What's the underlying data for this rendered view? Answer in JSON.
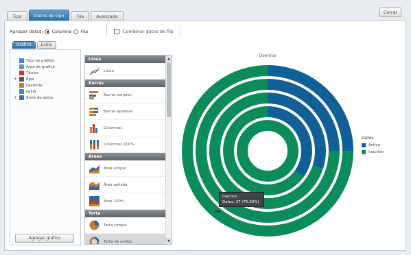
{
  "top_tabs": [
    "Tipo",
    "Datos de tipo",
    "Fila",
    "Avanzado"
  ],
  "close_label": "Cerrar",
  "options": {
    "prefix": "Agrupar datos:",
    "option_columns": "Columna",
    "option_rows": "Fila",
    "selected": "columns"
  },
  "checkbox_label": "Combinar datos de fila",
  "sub_tabs": [
    "Gráfico",
    "Estilo"
  ],
  "tree": [
    {
      "label": "Tipo de gráfico",
      "icon": "chart-type-icon",
      "color": "#4a7fc1",
      "indent": 0,
      "expander": ""
    },
    {
      "label": "Área de gráfico",
      "icon": "chart-area-icon",
      "color": "#6a8fb0",
      "indent": 0,
      "expander": ""
    },
    {
      "label": "Títulos",
      "icon": "titles-icon",
      "color": "#c0392b",
      "indent": 0,
      "expander": ""
    },
    {
      "label": "Ejes",
      "icon": "axis-icon",
      "color": "#555555",
      "indent": 0,
      "expander": "+"
    },
    {
      "label": "Leyenda",
      "icon": "legend-icon",
      "color": "#d07a1e",
      "indent": 0,
      "expander": ""
    },
    {
      "label": "Grilla",
      "icon": "grid-icon",
      "color": "#4a7fc1",
      "indent": 0,
      "expander": ""
    },
    {
      "label": "Serie de datos",
      "icon": "series-icon",
      "color": "#3a6ea5",
      "indent": 0,
      "expander": "+"
    }
  ],
  "add_chart_label": "Agregar gráfico",
  "gallery": {
    "sections": [
      {
        "header": "Línea",
        "items": [
          {
            "label": "Línea",
            "icon": "line-icon"
          }
        ]
      },
      {
        "header": "Barras",
        "items": [
          {
            "label": "Barras simples",
            "icon": "bar-simple-icon"
          },
          {
            "label": "Barras apiladas",
            "icon": "bar-stacked-icon"
          },
          {
            "label": "Columnas",
            "icon": "column-icon"
          },
          {
            "label": "Columnas 100%",
            "icon": "column-100-icon"
          }
        ]
      },
      {
        "header": "Áreas",
        "items": [
          {
            "label": "Área simple",
            "icon": "area-simple-icon"
          },
          {
            "label": "Área apilada",
            "icon": "area-stacked-icon"
          },
          {
            "label": "Área 100%",
            "icon": "area-100-icon"
          }
        ]
      },
      {
        "header": "Torta",
        "items": [
          {
            "label": "Torta simple",
            "icon": "pie-icon"
          },
          {
            "label": "Torta de anillos",
            "icon": "donut-icon",
            "selected": true
          }
        ]
      }
    ]
  },
  "colors": {
    "blue": "#115f97",
    "green": "#0c8c5a",
    "accent": "#2c6ea3"
  },
  "chart_data": {
    "type": "pie",
    "subtype": "multi-ring doughnut",
    "title": "Dominio",
    "legend_title": "Datos",
    "legend_position": "right",
    "series_names": [
      "Activo",
      "Inactivo"
    ],
    "rings": [
      {
        "values": [
          25,
          75
        ]
      },
      {
        "values": [
          25,
          75
        ]
      },
      {
        "values": [
          30,
          70
        ]
      },
      {
        "values": [
          35,
          65
        ]
      },
      {
        "values": [
          0,
          100
        ]
      }
    ],
    "tooltip": [
      "Inactivo",
      "Datos: 37 (75.00%)"
    ]
  }
}
